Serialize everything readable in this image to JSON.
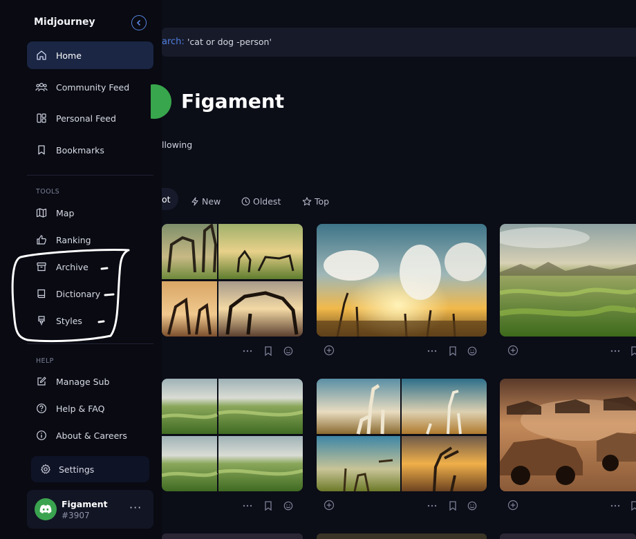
{
  "app": {
    "title": "Midjourney"
  },
  "sidebar": {
    "nav": [
      {
        "label": "Home",
        "icon": "home-icon",
        "active": true
      },
      {
        "label": "Community Feed",
        "icon": "community-icon"
      },
      {
        "label": "Personal Feed",
        "icon": "personal-feed-icon"
      },
      {
        "label": "Bookmarks",
        "icon": "bookmark-icon"
      }
    ],
    "tools_heading": "TOOLS",
    "tools": [
      {
        "label": "Map",
        "icon": "map-icon"
      },
      {
        "label": "Ranking",
        "icon": "thumbs-up-icon"
      },
      {
        "label": "Archive",
        "icon": "archive-icon"
      },
      {
        "label": "Dictionary",
        "icon": "book-icon"
      },
      {
        "label": "Styles",
        "icon": "brush-icon"
      }
    ],
    "help_heading": "HELP",
    "help": [
      {
        "label": "Manage Sub",
        "icon": "edit-icon"
      },
      {
        "label": "Help & FAQ",
        "icon": "help-icon"
      },
      {
        "label": "About & Careers",
        "icon": "info-icon"
      }
    ],
    "settings_label": "Settings",
    "user": {
      "name": "Figament",
      "tag": "#3907",
      "more": "···"
    }
  },
  "search": {
    "prefix": "arch:",
    "query": "'cat or dog -person'"
  },
  "profile": {
    "name": "Figament",
    "following_label": "llowing"
  },
  "sort_tabs": [
    {
      "label": "ot",
      "icon": "",
      "active": true
    },
    {
      "label": "New",
      "icon": "bolt-icon"
    },
    {
      "label": "Oldest",
      "icon": "clock-icon"
    },
    {
      "label": "Top",
      "icon": "star-icon"
    }
  ],
  "colors": {
    "accent": "#5a86e0",
    "sidebar_active": "#1a2644",
    "background": "#0b0d17",
    "avatar_green": "#3aa34f"
  }
}
